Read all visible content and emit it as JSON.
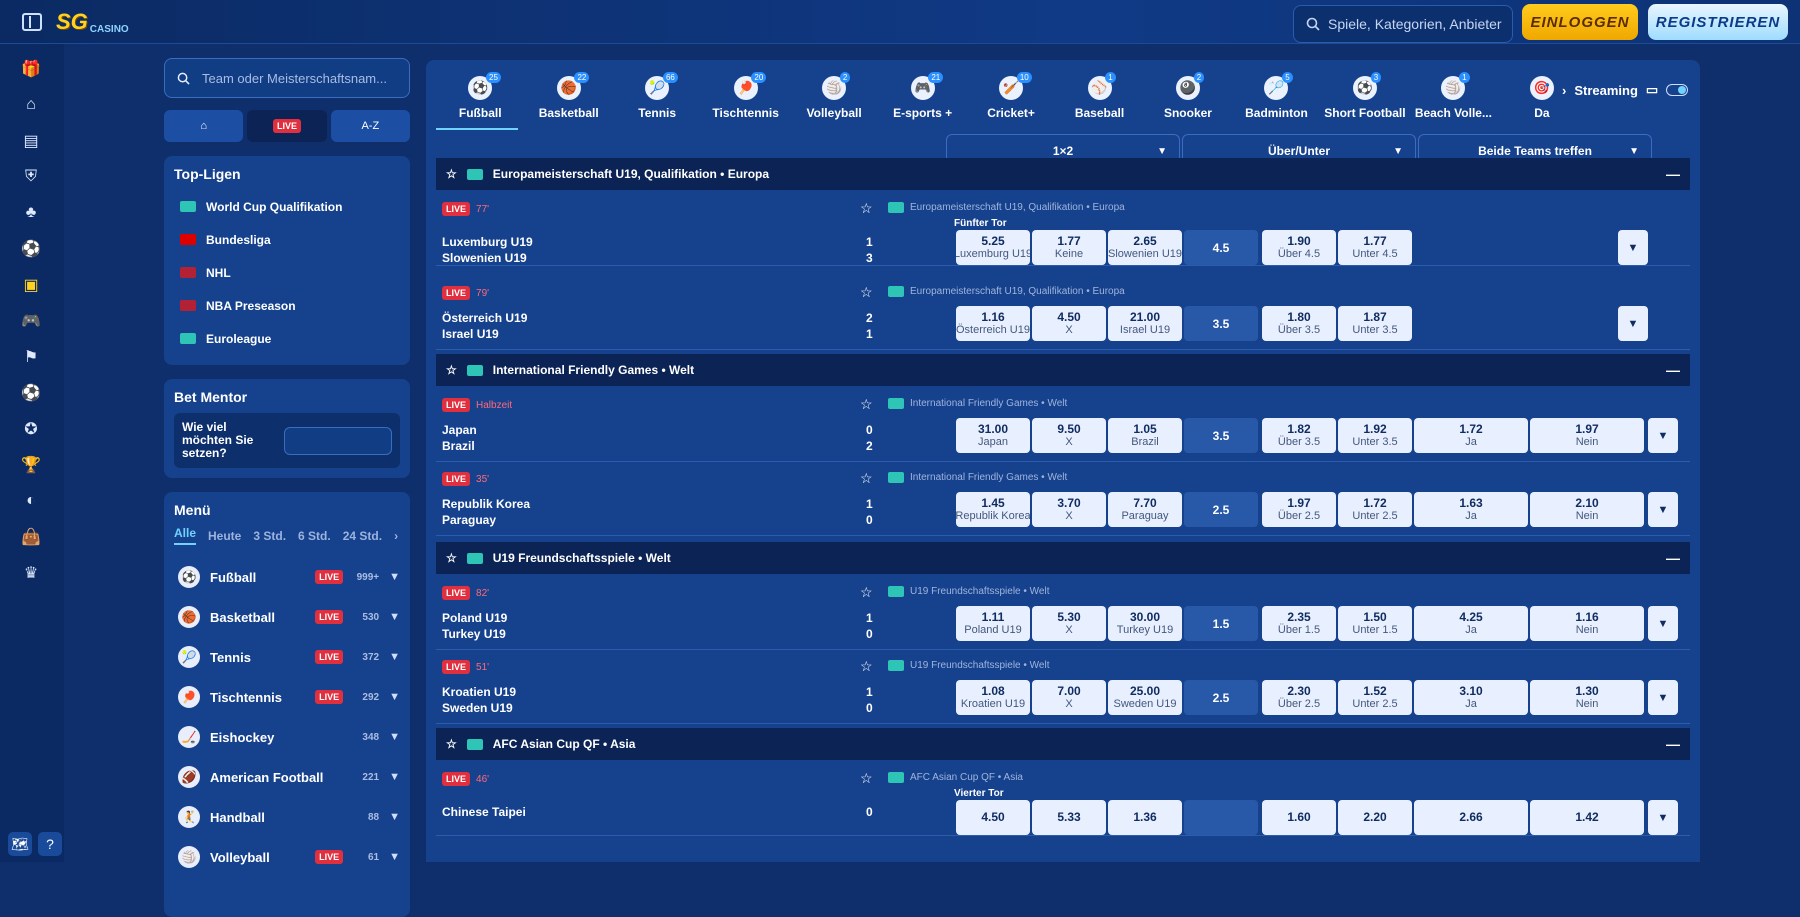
{
  "header": {
    "logo_main": "SG",
    "logo_sub": "CASINO",
    "search_placeholder": "Spiele, Kategorien, Anbieter",
    "login_label": "EINLOGGEN",
    "register_label": "REGISTRIEREN"
  },
  "sidebar": {
    "search_placeholder": "Team oder Meisterschaftsnam...",
    "tabs": [
      "⌂",
      "LIVE",
      "A-Z"
    ],
    "top_leagues_title": "Top-Ligen",
    "top_leagues": [
      {
        "name": "World Cup Qualifikation",
        "flag_color": "#2ec4b6"
      },
      {
        "name": "Bundesliga",
        "flag_color": "#dd0000"
      },
      {
        "name": "NHL",
        "flag_color": "#b22234"
      },
      {
        "name": "NBA Preseason",
        "flag_color": "#b22234"
      },
      {
        "name": "Euroleague",
        "flag_color": "#2ec4b6"
      }
    ],
    "bet_mentor_title": "Bet Mentor",
    "bet_mentor_question": "Wie viel möchten Sie setzen?",
    "menu_title": "Menü",
    "menu_filters": [
      "Alle",
      "Heute",
      "3 Std.",
      "6 Std.",
      "24 Std."
    ],
    "sports": [
      {
        "name": "Fußball",
        "live": true,
        "count": "999+",
        "icon": "⚽"
      },
      {
        "name": "Basketball",
        "live": true,
        "count": "530",
        "icon": "🏀"
      },
      {
        "name": "Tennis",
        "live": true,
        "count": "372",
        "icon": "🎾"
      },
      {
        "name": "Tischtennis",
        "live": true,
        "count": "292",
        "icon": "🏓"
      },
      {
        "name": "Eishockey",
        "live": false,
        "count": "348",
        "icon": "🏒"
      },
      {
        "name": "American Football",
        "live": false,
        "count": "221",
        "icon": "🏈"
      },
      {
        "name": "Handball",
        "live": false,
        "count": "88",
        "icon": "🤾"
      },
      {
        "name": "Volleyball",
        "live": true,
        "count": "61",
        "icon": "🏐"
      }
    ],
    "live_label": "LIVE"
  },
  "sport_tabs": [
    {
      "name": "Fußball",
      "count": "25",
      "icon": "⚽"
    },
    {
      "name": "Basketball",
      "count": "22",
      "icon": "🏀"
    },
    {
      "name": "Tennis",
      "count": "66",
      "icon": "🎾"
    },
    {
      "name": "Tischtennis",
      "count": "20",
      "icon": "🏓"
    },
    {
      "name": "Volleyball",
      "count": "2",
      "icon": "🏐"
    },
    {
      "name": "E-sports +",
      "count": "21",
      "icon": "🎮"
    },
    {
      "name": "Cricket+",
      "count": "10",
      "icon": "🏏"
    },
    {
      "name": "Baseball",
      "count": "1",
      "icon": "⚾"
    },
    {
      "name": "Snooker",
      "count": "2",
      "icon": "🎱"
    },
    {
      "name": "Badminton",
      "count": "5",
      "icon": "🏸"
    },
    {
      "name": "Short Football",
      "count": "3",
      "icon": "⚽"
    },
    {
      "name": "Beach Volle...",
      "count": "1",
      "icon": "🏐"
    },
    {
      "name": "Da",
      "count": "",
      "icon": "🎯"
    }
  ],
  "streaming_label": "Streaming",
  "markets": [
    "1×2",
    "Über/Unter",
    "Beide Teams treffen"
  ],
  "leagues": [
    {
      "title": "Europameisterschaft U19, Qualifikation • Europa"
    },
    {
      "title": "International Friendly Games • Welt"
    },
    {
      "title": "U19 Freundschaftsspiele • Welt"
    },
    {
      "title": "AFC Asian Cup QF • Asia"
    }
  ],
  "matches": [
    {
      "status": "77'",
      "league": "Europameisterschaft U19, Qualifikation • Europa",
      "market_title": "Fünfter Tor",
      "home": "Luxemburg U19",
      "away": "Slowenien U19",
      "score_home": "1",
      "score_away": "3",
      "odds": [
        [
          "5.25",
          "Luxemburg U19"
        ],
        [
          "1.77",
          "Keine"
        ],
        [
          "2.65",
          "Slowenien U19"
        ]
      ],
      "line": "4.5",
      "ou": [
        [
          "1.90",
          "Über 4.5"
        ],
        [
          "1.77",
          "Unter 4.5"
        ]
      ],
      "btts": []
    },
    {
      "status": "79'",
      "league": "Europameisterschaft U19, Qualifikation • Europa",
      "market_title": "",
      "home": "Österreich U19",
      "away": "Israel U19",
      "score_home": "2",
      "score_away": "1",
      "odds": [
        [
          "1.16",
          "Österreich U19"
        ],
        [
          "4.50",
          "X"
        ],
        [
          "21.00",
          "Israel U19"
        ]
      ],
      "line": "3.5",
      "ou": [
        [
          "1.80",
          "Über 3.5"
        ],
        [
          "1.87",
          "Unter 3.5"
        ]
      ],
      "btts": []
    },
    {
      "status": "Halbzeit",
      "league": "International Friendly Games • Welt",
      "market_title": "",
      "home": "Japan",
      "away": "Brazil",
      "score_home": "0",
      "score_away": "2",
      "odds": [
        [
          "31.00",
          "Japan"
        ],
        [
          "9.50",
          "X"
        ],
        [
          "1.05",
          "Brazil"
        ]
      ],
      "line": "3.5",
      "ou": [
        [
          "1.82",
          "Über 3.5"
        ],
        [
          "1.92",
          "Unter 3.5"
        ]
      ],
      "btts": [
        [
          "1.72",
          "Ja"
        ],
        [
          "1.97",
          "Nein"
        ]
      ]
    },
    {
      "status": "35'",
      "league": "International Friendly Games • Welt",
      "market_title": "",
      "home": "Republik Korea",
      "away": "Paraguay",
      "score_home": "1",
      "score_away": "0",
      "odds": [
        [
          "1.45",
          "Republik Korea"
        ],
        [
          "3.70",
          "X"
        ],
        [
          "7.70",
          "Paraguay"
        ]
      ],
      "line": "2.5",
      "ou": [
        [
          "1.97",
          "Über 2.5"
        ],
        [
          "1.72",
          "Unter 2.5"
        ]
      ],
      "btts": [
        [
          "1.63",
          "Ja"
        ],
        [
          "2.10",
          "Nein"
        ]
      ]
    },
    {
      "status": "82'",
      "league": "U19 Freundschaftsspiele • Welt",
      "market_title": "",
      "home": "Poland U19",
      "away": "Turkey U19",
      "score_home": "1",
      "score_away": "0",
      "odds": [
        [
          "1.11",
          "Poland U19"
        ],
        [
          "5.30",
          "X"
        ],
        [
          "30.00",
          "Turkey U19"
        ]
      ],
      "line": "1.5",
      "ou": [
        [
          "2.35",
          "Über 1.5"
        ],
        [
          "1.50",
          "Unter 1.5"
        ]
      ],
      "btts": [
        [
          "4.25",
          "Ja"
        ],
        [
          "1.16",
          "Nein"
        ]
      ]
    },
    {
      "status": "51'",
      "league": "U19 Freundschaftsspiele • Welt",
      "market_title": "",
      "home": "Kroatien U19",
      "away": "Sweden U19",
      "score_home": "1",
      "score_away": "0",
      "odds": [
        [
          "1.08",
          "Kroatien U19"
        ],
        [
          "7.00",
          "X"
        ],
        [
          "25.00",
          "Sweden U19"
        ]
      ],
      "line": "2.5",
      "ou": [
        [
          "2.30",
          "Über 2.5"
        ],
        [
          "1.52",
          "Unter 2.5"
        ]
      ],
      "btts": [
        [
          "3.10",
          "Ja"
        ],
        [
          "1.30",
          "Nein"
        ]
      ]
    },
    {
      "status": "46'",
      "league": "AFC Asian Cup QF • Asia",
      "market_title": "Vierter Tor",
      "home": "Chinese Taipei",
      "away": "",
      "score_home": "0",
      "score_away": "",
      "odds": [
        [
          "4.50",
          ""
        ],
        [
          "5.33",
          ""
        ],
        [
          "1.36",
          ""
        ]
      ],
      "line": "",
      "ou": [
        [
          "1.60",
          ""
        ],
        [
          "2.20",
          ""
        ]
      ],
      "btts": [
        [
          "2.66",
          ""
        ],
        [
          "1.42",
          ""
        ]
      ]
    }
  ]
}
